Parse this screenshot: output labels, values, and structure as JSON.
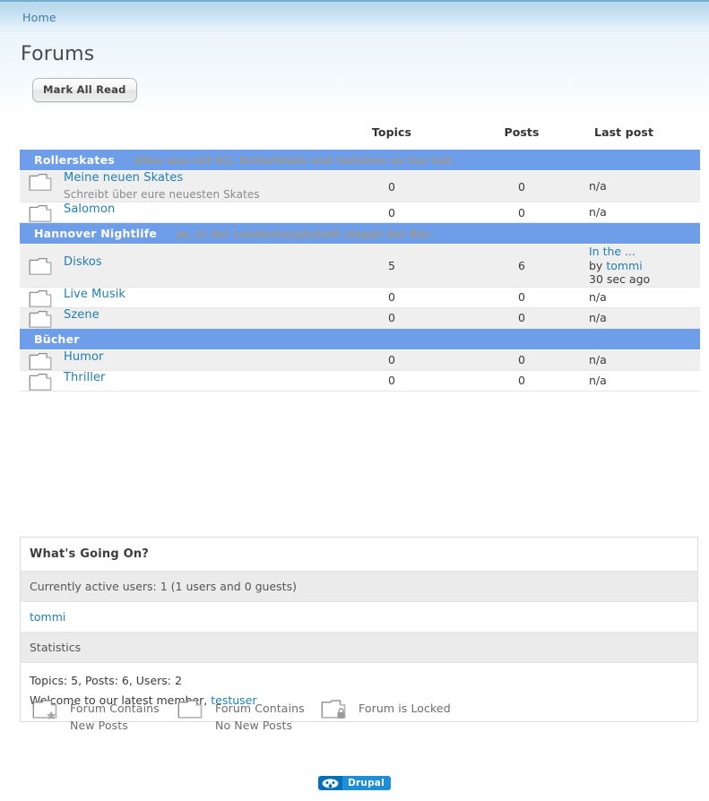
{
  "breadcrumb": {
    "home_label": "Home"
  },
  "page": {
    "title": "Forums"
  },
  "toolbar": {
    "mark_all_read_label": "Mark All Read"
  },
  "table": {
    "headers": {
      "name": "",
      "topics": "Topics",
      "posts": "Posts",
      "last_post": "Last post"
    },
    "sections": [
      {
        "title": "Rollerskates",
        "description": "Alles was mit K2, Rollerblade und Salomon zu tun hat.",
        "forums": [
          {
            "name": "Meine neuen Skates",
            "description": "Schreibt über eure neuesten Skates",
            "topics": "0",
            "posts": "0",
            "last_post": {
              "type": "none",
              "text": "n/a"
            }
          },
          {
            "name": "Salomon",
            "description": "",
            "topics": "0",
            "posts": "0",
            "last_post": {
              "type": "none",
              "text": "n/a"
            }
          }
        ]
      },
      {
        "title": "Hannover Nightlife",
        "description": "Ja, in der Landeshauptstadt steppt der Bär.",
        "forums": [
          {
            "name": "Diskos",
            "description": "",
            "topics": "5",
            "posts": "6",
            "last_post": {
              "type": "post",
              "title": "In the ...",
              "by_prefix": "by",
              "author": "tommi",
              "time": "30 sec ago"
            }
          },
          {
            "name": "Live Musik",
            "description": "",
            "topics": "0",
            "posts": "0",
            "last_post": {
              "type": "none",
              "text": "n/a"
            }
          },
          {
            "name": "Szene",
            "description": "",
            "topics": "0",
            "posts": "0",
            "last_post": {
              "type": "none",
              "text": "n/a"
            }
          }
        ]
      },
      {
        "title": "Bücher",
        "description": "",
        "forums": [
          {
            "name": "Humor",
            "description": "",
            "topics": "0",
            "posts": "0",
            "last_post": {
              "type": "none",
              "text": "n/a"
            }
          },
          {
            "name": "Thriller",
            "description": "",
            "topics": "0",
            "posts": "0",
            "last_post": {
              "type": "none",
              "text": "n/a"
            }
          }
        ]
      }
    ]
  },
  "whats_going_on": {
    "heading": "What's Going On?",
    "active_users_line": "Currently active users: 1 (1 users and 0 guests)",
    "active_user_link": "tommi",
    "statistics_heading": "Statistics",
    "statistics_line": "Topics: 5, Posts: 6, Users: 2",
    "welcome_prefix": "Welcome to our latest member,",
    "welcome_member": "testuser"
  },
  "legend": [
    {
      "icon": "folder-star-icon",
      "line1": "Forum Contains",
      "line2": "New Posts"
    },
    {
      "icon": "folder-icon",
      "line1": "Forum Contains",
      "line2": "No New Posts"
    },
    {
      "icon": "folder-lock-icon",
      "line1": "Forum is Locked",
      "line2": ""
    }
  ],
  "footer": {
    "drupal_label": "Drupal"
  },
  "colors": {
    "section_header_blue": "#6e9de9",
    "link_blue": "#1f7fb5",
    "breadcrumb_blue": "#3c7ea3",
    "row_odd": "#efefef",
    "row_even": "#ffffff",
    "section_desc_gray": "#9b9b95",
    "drupal_dark": "#0071b8",
    "drupal_light": "#1e8fd5"
  }
}
